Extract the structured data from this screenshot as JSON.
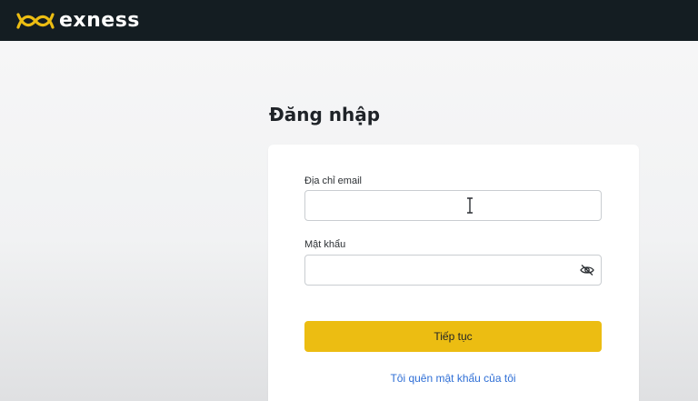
{
  "brand": {
    "name": "exness",
    "logo_icon": "exness-logo-icon",
    "accent_color": "#ecbd12",
    "topbar_color": "#141d22"
  },
  "login": {
    "title": "Đăng nhập",
    "email_label": "Địa chỉ email",
    "email_value": "",
    "password_label": "Mật khẩu",
    "password_value": "",
    "password_toggle_icon": "eye-off-icon",
    "submit_label": "Tiếp tục",
    "forgot_link": "Tôi quên mật khẩu của tôi",
    "link_color": "#2f6fd6"
  }
}
